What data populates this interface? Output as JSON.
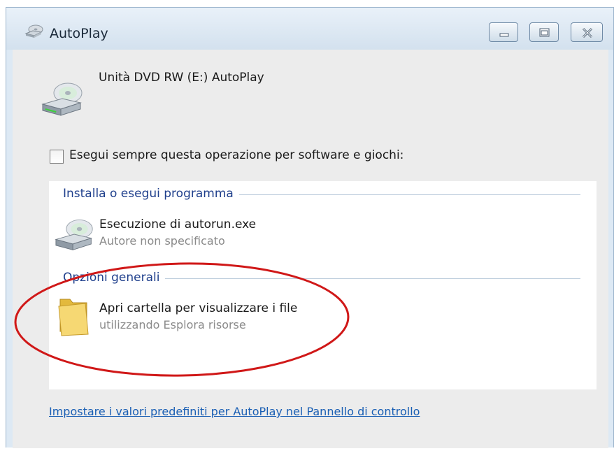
{
  "window": {
    "title": "AutoPlay",
    "controls": [
      "minimize",
      "maximize",
      "close"
    ]
  },
  "header": {
    "text": "Unità DVD RW (E:) AutoPlay",
    "icon": "dvd-drive-icon"
  },
  "always_do": {
    "label": "Esegui sempre questa operazione per software e giochi:",
    "checked": false
  },
  "groups": [
    {
      "header": "Installa o esegui programma",
      "options": [
        {
          "title": "Esecuzione di autorun.exe",
          "subtitle": "Autore non specificato",
          "icon": "dvd-drive-icon"
        }
      ]
    },
    {
      "header": "Opzioni generali",
      "options": [
        {
          "title": "Apri cartella per visualizzare i file",
          "subtitle": "utilizzando Esplora risorse",
          "icon": "folder-icon"
        }
      ]
    }
  ],
  "footer_link": "Impostare i valori predefiniti per AutoPlay nel Pannello di controllo",
  "colors": {
    "group_header": "#1f3f8c",
    "link": "#1a5fb4",
    "annotation": "#d01818"
  }
}
